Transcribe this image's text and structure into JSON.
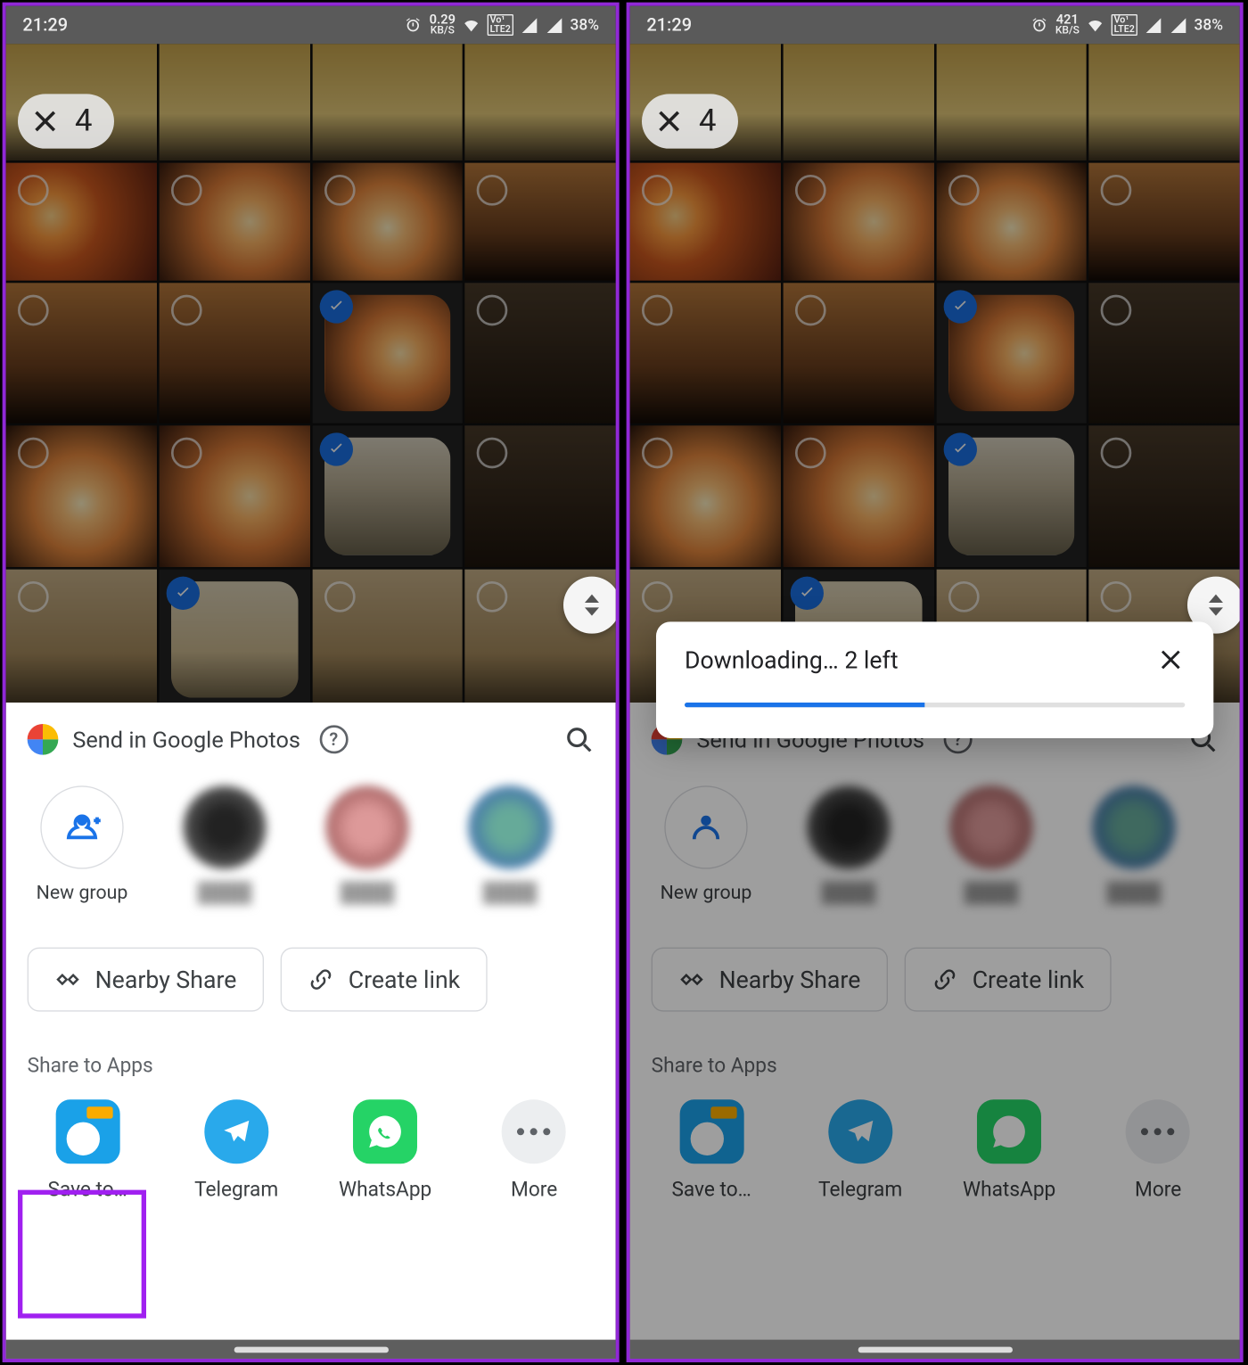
{
  "statusbar": {
    "time": "21:29",
    "net_a": {
      "top": "0.29",
      "bottom": "KB/S"
    },
    "net_b": {
      "top": "421",
      "bottom": "KB/S"
    },
    "lte1": "VoLTE 1",
    "lte2": "LTE 2",
    "battery": "38%"
  },
  "selection": {
    "count": "4"
  },
  "share": {
    "title": "Send in Google Photos",
    "new_group": "New group",
    "nearby": "Nearby Share",
    "create_link": "Create link",
    "share_to_apps": "Share to Apps",
    "apps": {
      "save": "Save to…",
      "telegram": "Telegram",
      "whatsapp": "WhatsApp",
      "more": "More"
    }
  },
  "toast": {
    "message": "Downloading… 2 left",
    "progress_pct": 48
  }
}
